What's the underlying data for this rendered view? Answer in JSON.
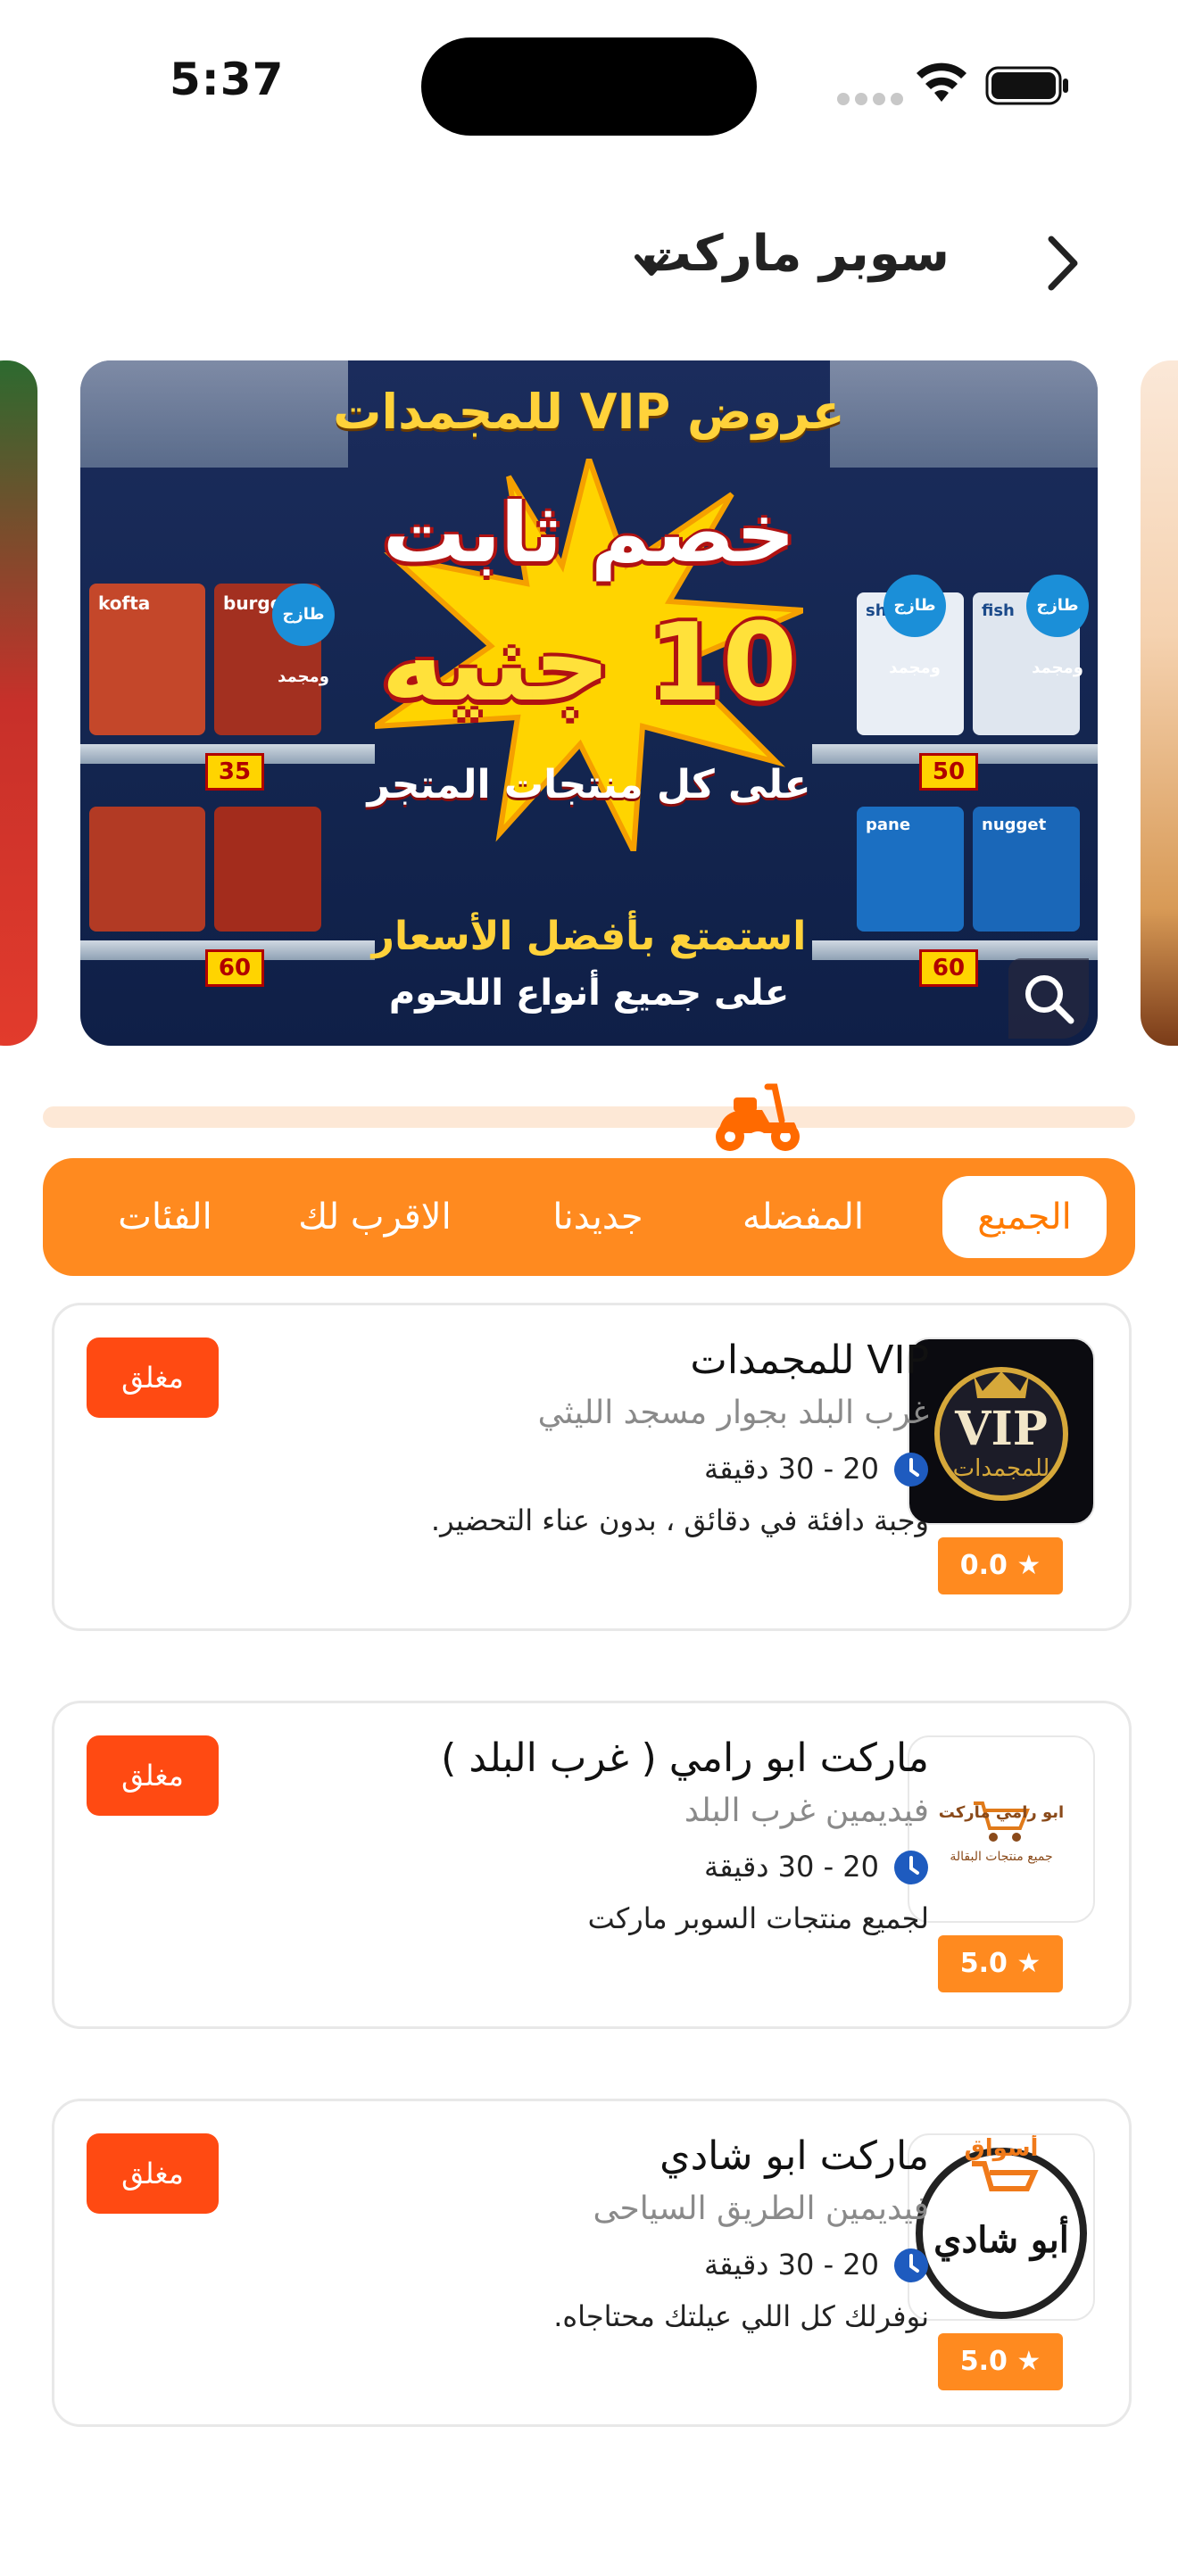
{
  "status_bar": {
    "time": "5:37"
  },
  "header": {
    "title": "سوبر ماركت"
  },
  "banner": {
    "headline": "عروض VIP للمجمدات",
    "discount_line1": "خصم ثابت",
    "discount_line2": "10 جنيه",
    "discount_line3": "على كل منتجات المتجر",
    "footer_line1": "استمتع بأفضل الأسعار",
    "footer_line2": "على جميع أنواع اللحوم",
    "fresh_label": "طازج ومجمد",
    "price_tags": [
      "35",
      "60",
      "50",
      "60"
    ],
    "product_labels": [
      "kofta",
      "burger",
      "shrimp",
      "fish",
      "pane",
      "nugget"
    ]
  },
  "tabs": [
    {
      "label": "الجميع",
      "active": true
    },
    {
      "label": "المفضله",
      "active": false
    },
    {
      "label": "جديدنا",
      "active": false
    },
    {
      "label": "الاقرب لك",
      "active": false
    },
    {
      "label": "الفئات",
      "active": false
    }
  ],
  "stores": [
    {
      "name": "VIP للمجمدات",
      "location": "غرب البلد بجوار مسجد الليثي",
      "time": "20 - 30 دقيقة",
      "description": "وجبة دافئة في دقائق ، بدون عناء التحضير.",
      "rating": "0.0",
      "status": "مغلق",
      "logo_text": "VIP",
      "logo_subtext": "للمجمدات"
    },
    {
      "name": "ماركت ابو رامي ( غرب البلد )",
      "location": "فيديمين غرب البلد",
      "time": "20 - 30 دقيقة",
      "description": "لجميع منتجات السوبر ماركت",
      "rating": "5.0",
      "status": "مغلق",
      "logo_text": "ابو رامي ماركت",
      "logo_subtext": "جميع منتجات البقالة"
    },
    {
      "name": "ماركت ابو شادي",
      "location": "فيديمين الطريق السياحى",
      "time": "20 - 30 دقيقة",
      "description": "نوفرلك كل اللي عيلتك محتاجاه.",
      "rating": "5.0",
      "status": "مغلق",
      "logo_text": "أبو شادي",
      "logo_subtext": "أسواق"
    }
  ],
  "colors": {
    "accent": "#ff8a1f",
    "closed": "#ff4a12",
    "track": "#fde8d6",
    "clock": "#1e5bbf"
  }
}
